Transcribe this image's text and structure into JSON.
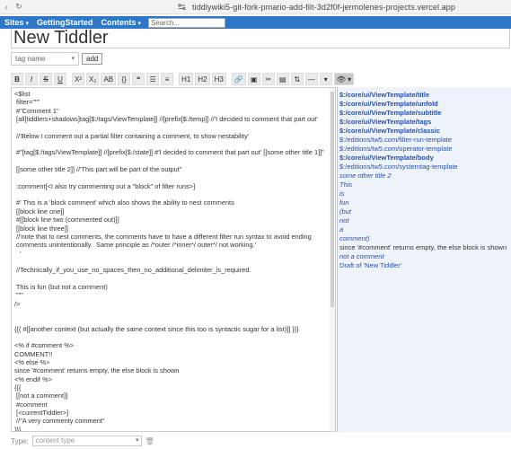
{
  "browser": {
    "url": "tiddlywiki5-git-fork-pmario-add-filt-3d2f0f-jermolenes-projects.vercel.app"
  },
  "menubar": {
    "items": [
      {
        "label": "Sites",
        "has_caret": true
      },
      {
        "label": "GettingStarted",
        "has_caret": false
      },
      {
        "label": "Contents",
        "has_caret": true
      }
    ],
    "search_placeholder": "Search..."
  },
  "editor": {
    "title": "New Tiddler",
    "tag_placeholder": "tag name",
    "add_label": "add",
    "toolbar": [
      {
        "name": "bold-button",
        "label": "B",
        "style": "bold"
      },
      {
        "name": "italic-button",
        "label": "I",
        "style": "italic"
      },
      {
        "name": "strikethrough-button",
        "label": "S",
        "style": "strike"
      },
      {
        "name": "underline-button",
        "label": "U",
        "style": "under"
      },
      {
        "name": "superscript-button",
        "label": "X²",
        "style": ""
      },
      {
        "name": "subscript-button",
        "label": "X₂",
        "style": ""
      },
      {
        "name": "monospace-button",
        "label": "AB",
        "style": ""
      },
      {
        "name": "code-block-button",
        "label": "{}",
        "style": ""
      },
      {
        "name": "quote-button",
        "label": "❝",
        "style": ""
      },
      {
        "name": "bullet-list-button",
        "label": "☰",
        "style": ""
      },
      {
        "name": "numbered-list-button",
        "label": "≡",
        "style": ""
      },
      {
        "name": "heading-1-button",
        "label": "H1",
        "style": ""
      },
      {
        "name": "heading-2-button",
        "label": "H2",
        "style": ""
      },
      {
        "name": "heading-3-button",
        "label": "H3",
        "style": ""
      },
      {
        "name": "link-button",
        "label": "🔗",
        "style": ""
      },
      {
        "name": "image-button",
        "label": "▣",
        "style": ""
      },
      {
        "name": "excise-button",
        "label": "✂",
        "style": ""
      },
      {
        "name": "picture-button",
        "label": "▤",
        "style": ""
      },
      {
        "name": "stamp-button",
        "label": "⇅",
        "style": ""
      },
      {
        "name": "rule-button",
        "label": "—",
        "style": ""
      },
      {
        "name": "more-button",
        "label": "▾",
        "style": ""
      },
      {
        "name": "preview-toggle-button",
        "label": "👁 ▾",
        "style": "active"
      }
    ],
    "text_lines": [
      "<$list",
      " filter=\"\"\"",
      " #\"Comment 1\"",
      " [all[tiddlers+shadows]tag[$:/tags/ViewTemplate]] //[prefix[$:/temp]] //'I decided to comment that part out'",
      "",
      " //'Below I comment out a partial filter containing a comment, to show nestability'",
      "",
      " #\"[tag[$:/tags/ViewTemplate]] //[prefix[$:/state]] #'I decided to comment that part out' [[some other title 1]]\"",
      "",
      " [[some other title 2]] //'This part will be part of the output\"",
      "",
      " :comment[<I also try commenting out a \"block\" of filter runs>]",
      "",
      " #' This is a 'block comment' which also shows the ability to nest comments",
      " [[block line one]]",
      " #[[block line two (commented out)]]",
      " [[block line three]]",
      " //'note that to nest comments, the comments have to have a different filter run syntax to avoid ending",
      " comments unintentionally.  Same principle as /*outer /*inner*/ outer*/ not working.'",
      "   '",
      "",
      " //Technically_if_you_use_no_spaces_then_no_additional_delimiter_is_required.",
      "",
      " This is fun (but not a comment)",
      " \"\"\"",
      "/>",
      "",
      "",
      "{{{ #[[another context (but actually the same context since this too is syntactic sugar for a list)]] }}}",
      "",
      "<% if #comment %>",
      "COMMENT!!",
      "<% else %>",
      "since '#comment' returns empty, the else block is shown",
      "<% endif %>",
      "{{{",
      " [[not a comment]]",
      " #comment",
      " [<currentTiddler>]",
      " //\"A very commenty comment\"",
      "}}}"
    ],
    "type_label": "Type:",
    "type_placeholder": "content type"
  },
  "preview": {
    "lines": [
      {
        "text": "$:/core/ui/ViewTemplate/title",
        "kind": "link-bold"
      },
      {
        "text": "$:/core/ui/ViewTemplate/unfold",
        "kind": "link-bold"
      },
      {
        "text": "$:/core/ui/ViewTemplate/subtitle",
        "kind": "link-bold"
      },
      {
        "text": "$:/core/ui/ViewTemplate/tags",
        "kind": "link-bold"
      },
      {
        "text": "$:/core/ui/ViewTemplate/classic",
        "kind": "link-bold"
      },
      {
        "text": "$:/editions/tw5.com/filter-run-template",
        "kind": "link"
      },
      {
        "text": "$:/editions/tw5.com/operator-template",
        "kind": "link"
      },
      {
        "text": "$:/core/ui/ViewTemplate/body",
        "kind": "link-bold"
      },
      {
        "text": "$:/editions/tw5.com/systemtag-template",
        "kind": "link"
      },
      {
        "text": "some other title 2",
        "kind": "italic"
      },
      {
        "text": "This",
        "kind": "italic"
      },
      {
        "text": "is",
        "kind": "italic"
      },
      {
        "text": "fun",
        "kind": "italic"
      },
      {
        "text": "(but",
        "kind": "italic"
      },
      {
        "text": "not",
        "kind": "italic"
      },
      {
        "text": "a",
        "kind": "italic"
      },
      {
        "text": "comment)",
        "kind": "italic"
      },
      {
        "text": "since '#comment' returns empty, the else block is shown",
        "kind": "plain"
      },
      {
        "text": "not a comment",
        "kind": "italic"
      },
      {
        "text": "Draft of 'New Tiddler'",
        "kind": "link"
      }
    ]
  },
  "colors": {
    "menubar": "#2e76c8",
    "preview_bg": "#eef3fb",
    "link": "#2250b0"
  }
}
